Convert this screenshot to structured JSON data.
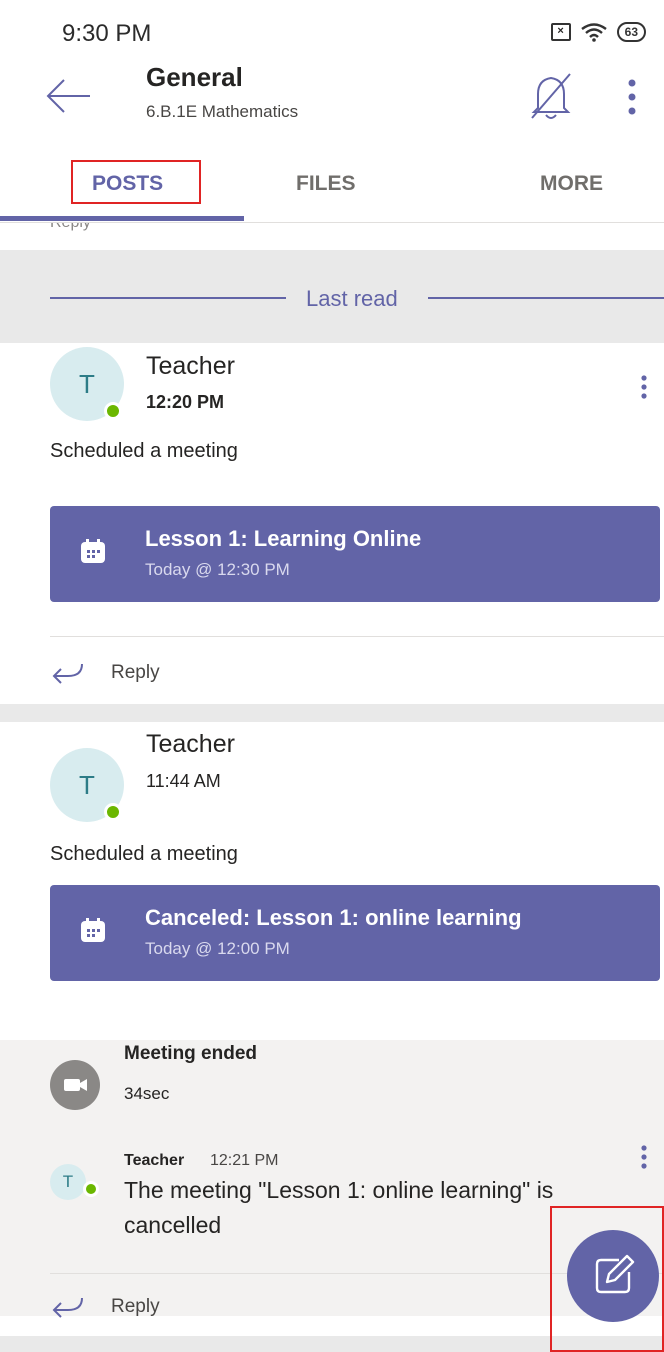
{
  "status_bar": {
    "time": "9:30 PM",
    "battery": "63"
  },
  "header": {
    "title": "General",
    "subtitle": "6.B.1E Mathematics"
  },
  "tabs": [
    {
      "label": "POSTS",
      "active": true
    },
    {
      "label": "FILES",
      "active": false
    },
    {
      "label": "MORE",
      "active": false
    }
  ],
  "reply_peek": "Reply",
  "last_read_label": "Last read",
  "posts": [
    {
      "avatar_initial": "T",
      "author": "Teacher",
      "time": "12:20 PM",
      "action": "Scheduled a meeting",
      "meeting_title": "Lesson 1: Learning Online",
      "meeting_when": "Today @ 12:30 PM",
      "reply_label": "Reply"
    },
    {
      "avatar_initial": "T",
      "author": "Teacher",
      "time": "11:44 AM",
      "action": "Scheduled a meeting",
      "meeting_title": "Canceled: Lesson 1: online learning",
      "meeting_when": "Today @ 12:00 PM",
      "meeting_ended": {
        "title": "Meeting ended",
        "duration": "34sec"
      },
      "reply_message": {
        "avatar_initial": "T",
        "author": "Teacher",
        "time": "12:21 PM",
        "text_line1": "The meeting \"Lesson 1: online learning\" is",
        "text_line2": "cancelled"
      },
      "reply_label": "Reply"
    }
  ],
  "colors": {
    "accent": "#6264a7",
    "presence": "#6bb700",
    "highlight": "#e02424"
  }
}
